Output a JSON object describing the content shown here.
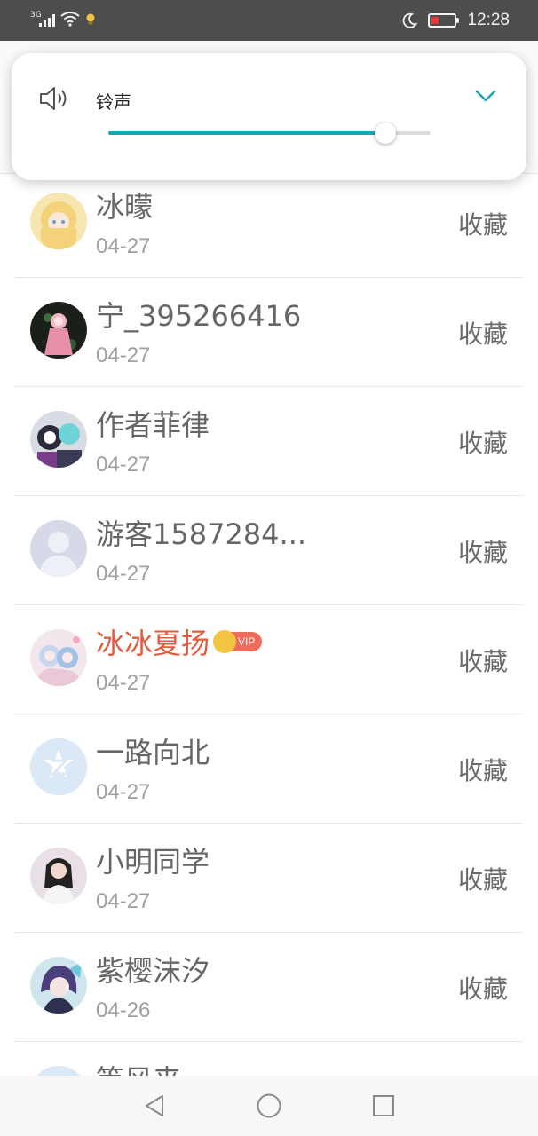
{
  "status_bar": {
    "network": "3G",
    "time": "12:28",
    "battery_percent": 8
  },
  "volume_panel": {
    "label": "铃声",
    "level": 0.86,
    "icons": [
      "speaker-icon",
      "chevron-down-icon"
    ]
  },
  "list": {
    "items": [
      {
        "name": "冰曚",
        "date": "04-27",
        "action": "收藏",
        "vip": false,
        "avatar": "anime-girl-blonde"
      },
      {
        "name": "宁_395266416",
        "date": "04-27",
        "action": "收藏",
        "vip": false,
        "avatar": "anime-pink-dark"
      },
      {
        "name": "作者菲律",
        "date": "04-27",
        "action": "收藏",
        "vip": false,
        "avatar": "anime-characters"
      },
      {
        "name": "游客1587284...",
        "date": "04-27",
        "action": "收藏",
        "vip": false,
        "avatar": "default-person"
      },
      {
        "name": "冰冰夏扬",
        "date": "04-27",
        "action": "收藏",
        "vip": true,
        "vip_label": "VIP",
        "avatar": "anime-pastel"
      },
      {
        "name": "一路向北",
        "date": "04-27",
        "action": "收藏",
        "vip": false,
        "avatar": "qq-default"
      },
      {
        "name": "小明同学",
        "date": "04-27",
        "action": "收藏",
        "vip": false,
        "avatar": "photo-girl"
      },
      {
        "name": "紫樱沫汐",
        "date": "04-26",
        "action": "收藏",
        "vip": false,
        "avatar": "anime-blue-hair"
      },
      {
        "name": "等风来",
        "date": "",
        "action": "",
        "vip": false,
        "avatar": "qq-default"
      }
    ]
  },
  "nav_bar": {
    "icons": [
      "back-icon",
      "home-icon",
      "recents-icon"
    ]
  },
  "colors": {
    "accent": "#1ba6b8",
    "vip_name": "#e05a3e",
    "status_bar": "#4d4d4d",
    "battery_low": "#e53935"
  }
}
